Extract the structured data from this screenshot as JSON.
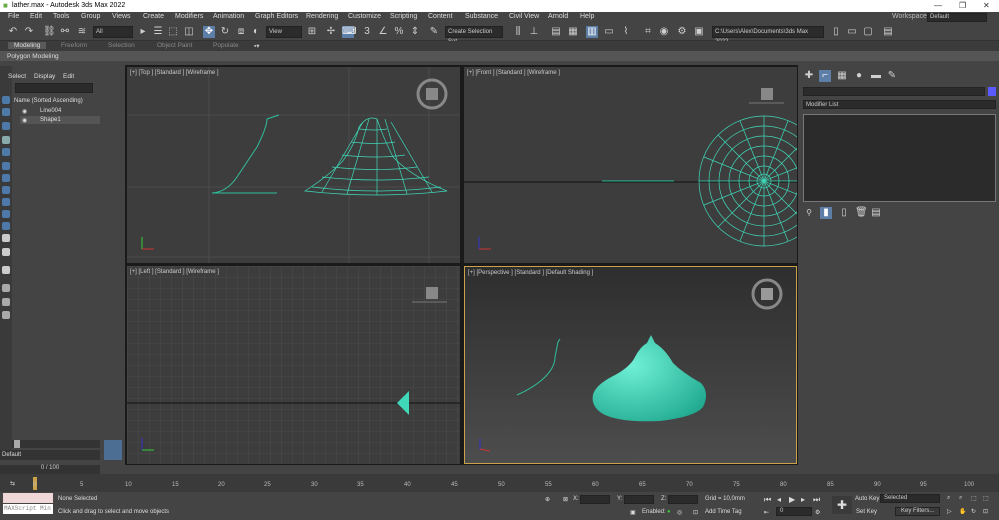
{
  "window": {
    "title": "lather.max - Autodesk 3ds Max 2022",
    "min": "—",
    "max": "❐",
    "close": "✕"
  },
  "menu": [
    "File",
    "Edit",
    "Tools",
    "Group",
    "Views",
    "Create",
    "Modifiers",
    "Animation",
    "Graph Editors",
    "Rendering",
    "Customize",
    "Scripting",
    "Content",
    "Substance",
    "Civil View",
    "Arnold",
    "Help"
  ],
  "workspaces": {
    "label": "Workspaces:",
    "value": "Default"
  },
  "toolbar": {
    "filter": "All",
    "ref_coord": "View",
    "selection_set": "Create Selection Set",
    "project_path": "C:\\Users\\Alex\\Documents\\3ds Max 2022"
  },
  "ribbon": {
    "tabs": [
      "Modeling",
      "Freeform",
      "Selection",
      "Object Paint",
      "Populate"
    ],
    "active": "Modeling",
    "sub": "Polygon Modeling"
  },
  "scene_explorer": {
    "tabs": [
      "Select",
      "Display",
      "Edit"
    ],
    "header": "Name (Sorted Ascending)",
    "items": [
      "Line004",
      "Shape1"
    ],
    "layer": "Default",
    "frame": "0 / 100"
  },
  "viewports": {
    "top": "[+] [Top ] [Standard ] [Wireframe ]",
    "front": "[+] [Front ] [Standard ] [Wireframe ]",
    "left": "[+] [Left ] [Standard ] [Wireframe ]",
    "perspective": "[+] [Perspective ] [Standard ] [Default Shading ]"
  },
  "command_panel": {
    "modifier_list": "Modifier List"
  },
  "timeline": {
    "ticks": [
      "0",
      "5",
      "10",
      "15",
      "20",
      "25",
      "30",
      "35",
      "40",
      "45",
      "50",
      "55",
      "60",
      "65",
      "70",
      "75",
      "80",
      "85",
      "90",
      "95",
      "100"
    ]
  },
  "status": {
    "maxscript": "MAXScript Min",
    "selected": "None Selected",
    "prompt": "Click and drag to select and move objects",
    "x_label": "X:",
    "y_label": "Y:",
    "z_label": "Z:",
    "grid": "Grid = 10,0mm",
    "enabled": "Enabled:",
    "add_time_tag": "Add Time Tag",
    "auto_key": "Auto Key",
    "set_key": "Set Key",
    "selected_dd": "Selected",
    "key_filters": "Key Filters...",
    "frame_value": "0"
  },
  "colors": {
    "accent": "#5d7ea7",
    "mesh": "#3fd8b8",
    "spline": "#2fbf9a"
  }
}
